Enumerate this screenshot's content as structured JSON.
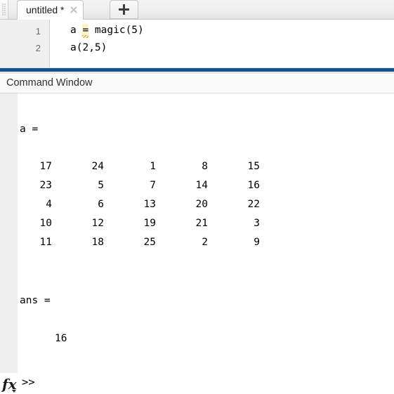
{
  "editor": {
    "grip_icon": "drag-grip-dots-icon",
    "tabs": [
      {
        "label": "untitled *",
        "close_icon": "close-x-icon",
        "active": true
      }
    ],
    "new_tab_icon": "plus-icon",
    "line_numbers": [
      "1",
      "2"
    ],
    "code_lines": [
      {
        "before": "a ",
        "warn": "=",
        "after": " magic(5)"
      },
      {
        "before": "a(2,5)",
        "warn": "",
        "after": ""
      }
    ]
  },
  "command_window": {
    "title": "Command Window",
    "var_a_label": "a =",
    "matrix": [
      [
        "17",
        "24",
        "1",
        "8",
        "15"
      ],
      [
        "23",
        "5",
        "7",
        "14",
        "16"
      ],
      [
        "4",
        "6",
        "13",
        "20",
        "22"
      ],
      [
        "10",
        "12",
        "19",
        "21",
        "3"
      ],
      [
        "11",
        "18",
        "25",
        "2",
        "9"
      ]
    ],
    "ans_label": "ans =",
    "ans_value": "16",
    "fx_icon": "fx-function-browser-icon",
    "prompt": ">>",
    "prompt_value": "",
    "prompt_placeholder": ""
  }
}
